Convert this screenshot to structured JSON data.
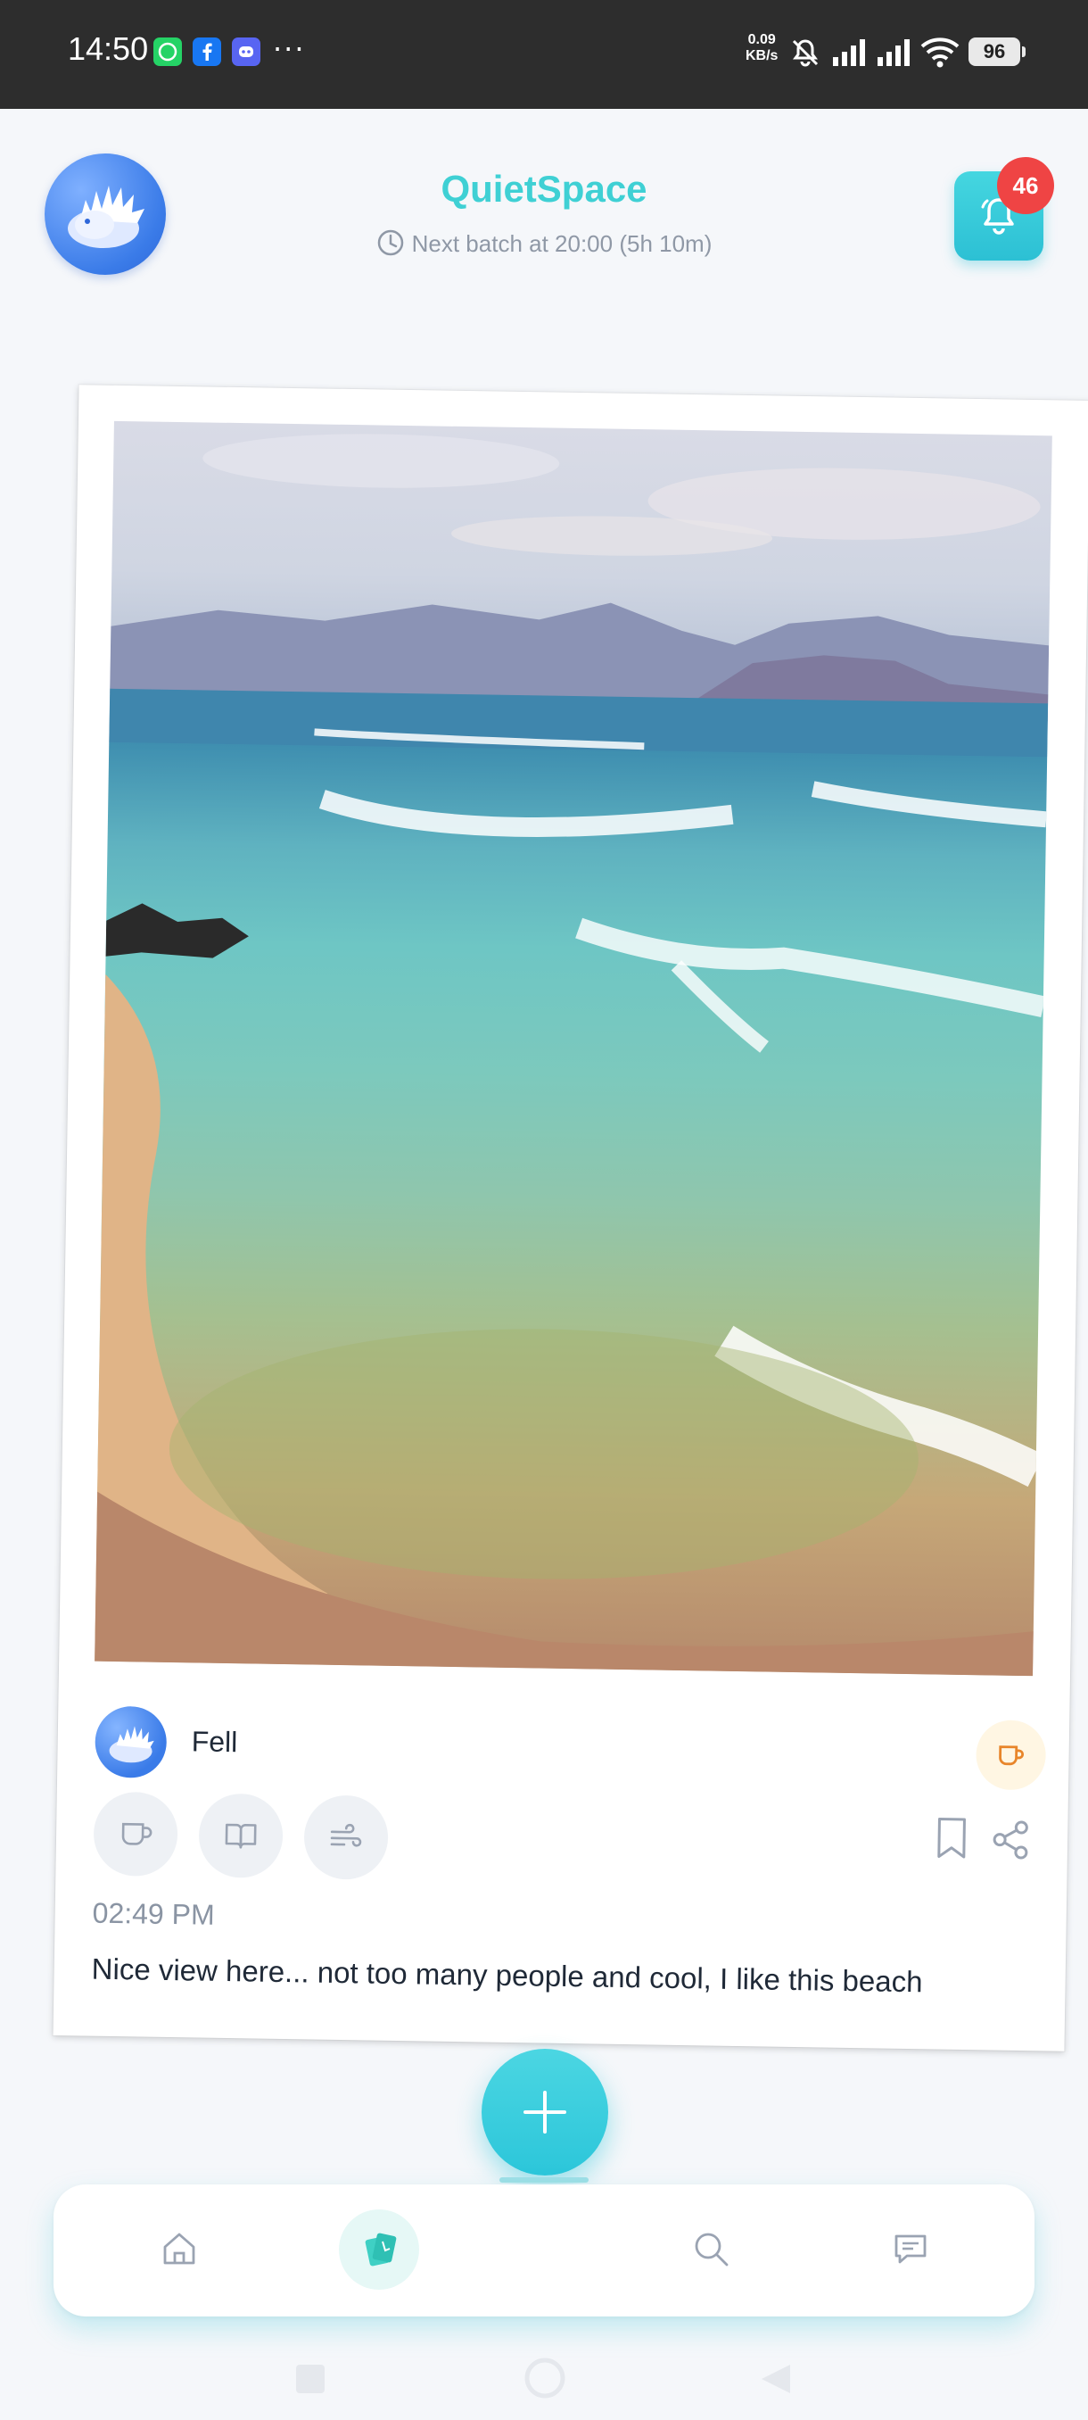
{
  "status_bar": {
    "time": "14:50",
    "apps": [
      "whatsapp-icon",
      "facebook-icon",
      "discord-icon"
    ],
    "more": "···",
    "net_speed_value": "0.09",
    "net_speed_unit": "KB/s",
    "battery": "96"
  },
  "header": {
    "title": "QuietSpace",
    "batch_text": "Next batch at 20:00 (5h 10m)",
    "notification_count": "46"
  },
  "post": {
    "author": "Fell",
    "time": "02:49 PM",
    "caption": "Nice view here... not too many people and cool, I like this beach",
    "reactions": [
      "coffee-icon",
      "book-icon",
      "wind-icon"
    ]
  },
  "bottom_nav": {
    "items": [
      "home",
      "cards",
      "search",
      "messages"
    ],
    "active": "cards"
  },
  "colors": {
    "accent": "#3fd0d4",
    "badge": "#ef4444",
    "status_bar": "#2d2d2d"
  }
}
